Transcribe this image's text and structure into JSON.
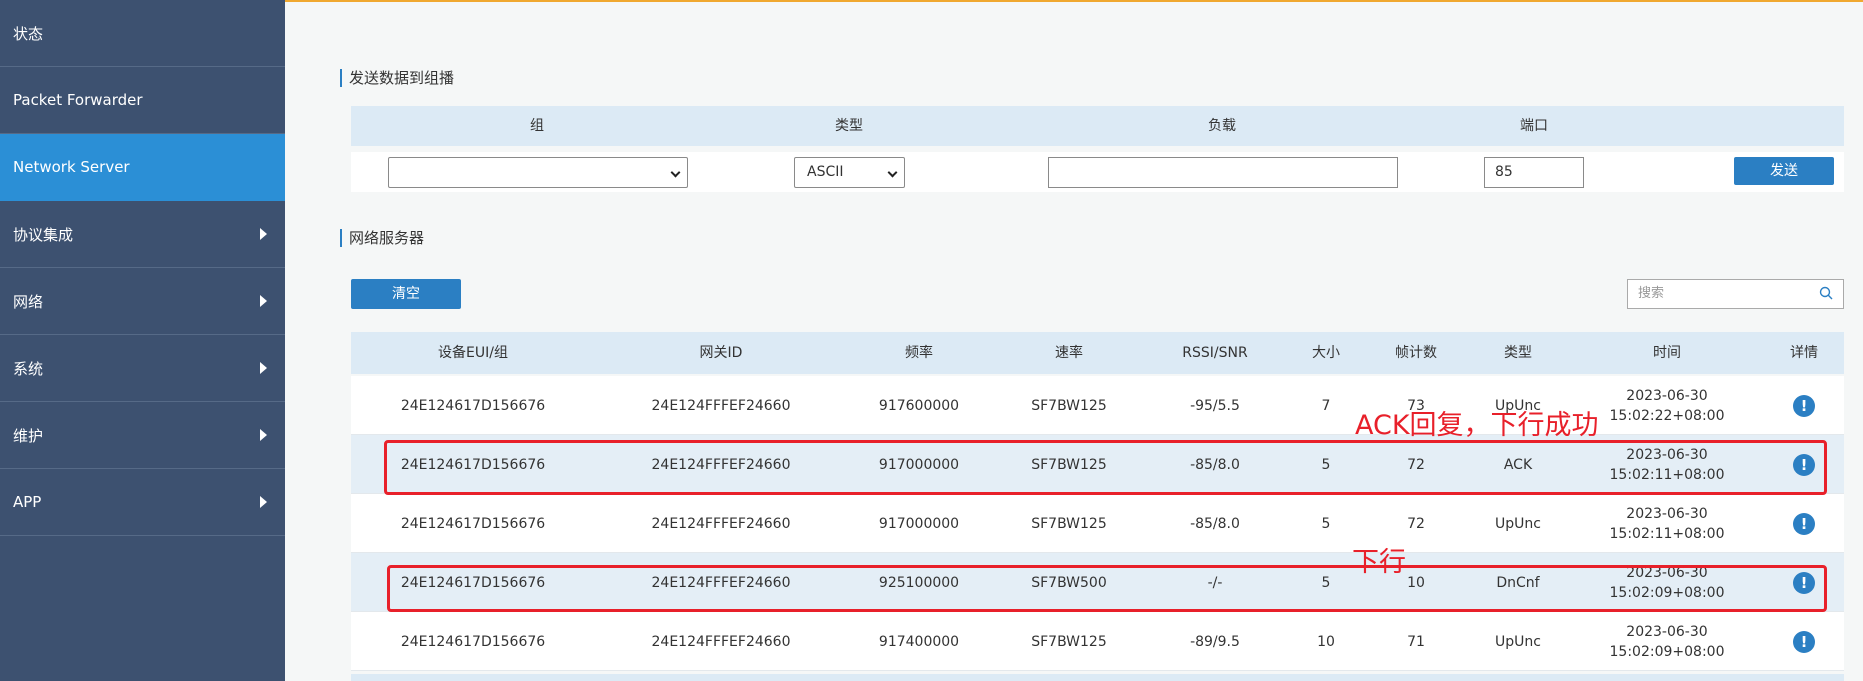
{
  "sidebar": {
    "items": [
      {
        "label": "状态"
      },
      {
        "label": "Packet Forwarder"
      },
      {
        "label": "Network Server"
      },
      {
        "label": "协议集成"
      },
      {
        "label": "网络"
      },
      {
        "label": "系统"
      },
      {
        "label": "维护"
      },
      {
        "label": "APP"
      }
    ]
  },
  "multicast": {
    "title": "发送数据到组播",
    "headers": [
      "组",
      "类型",
      "负载",
      "端口"
    ],
    "group_value": "",
    "type_value": "ASCII",
    "payload_value": "",
    "port_value": "85",
    "send_label": "发送"
  },
  "network_server": {
    "title": "网络服务器",
    "clear_label": "清空",
    "search_placeholder": "搜索"
  },
  "table": {
    "headers": [
      "设备EUI/组",
      "网关ID",
      "频率",
      "速率",
      "RSSI/SNR",
      "大小",
      "帧计数",
      "类型",
      "时间",
      "详情"
    ],
    "rows": [
      {
        "eui": "24E124617D156676",
        "gateway": "24E124FFFEF24660",
        "freq": "917600000",
        "rate": "SF7BW125",
        "rssi": "-95/5.5",
        "size": "7",
        "fcnt": "73",
        "type": "UpUnc",
        "date": "2023-06-30",
        "time": "15:02:22+08:00"
      },
      {
        "eui": "24E124617D156676",
        "gateway": "24E124FFFEF24660",
        "freq": "917000000",
        "rate": "SF7BW125",
        "rssi": "-85/8.0",
        "size": "5",
        "fcnt": "72",
        "type": "ACK",
        "date": "2023-06-30",
        "time": "15:02:11+08:00"
      },
      {
        "eui": "24E124617D156676",
        "gateway": "24E124FFFEF24660",
        "freq": "917000000",
        "rate": "SF7BW125",
        "rssi": "-85/8.0",
        "size": "5",
        "fcnt": "72",
        "type": "UpUnc",
        "date": "2023-06-30",
        "time": "15:02:11+08:00"
      },
      {
        "eui": "24E124617D156676",
        "gateway": "24E124FFFEF24660",
        "freq": "925100000",
        "rate": "SF7BW500",
        "rssi": "-/-",
        "size": "5",
        "fcnt": "10",
        "type": "DnCnf",
        "date": "2023-06-30",
        "time": "15:02:09+08:00"
      },
      {
        "eui": "24E124617D156676",
        "gateway": "24E124FFFEF24660",
        "freq": "917400000",
        "rate": "SF7BW125",
        "rssi": "-89/9.5",
        "size": "10",
        "fcnt": "71",
        "type": "UpUnc",
        "date": "2023-06-30",
        "time": "15:02:09+08:00"
      }
    ]
  },
  "annotations": {
    "ack_text": "ACK回复，下行成功",
    "downlink_text": "下行"
  },
  "icons": {
    "info": "info-circle-icon",
    "search": "search-icon",
    "chevron": "chevron-right-icon"
  },
  "colors": {
    "sidebar_bg": "#3d5170",
    "sidebar_active": "#2b8fd6",
    "accent": "#2b7fc3",
    "annotation": "#e8202a"
  }
}
